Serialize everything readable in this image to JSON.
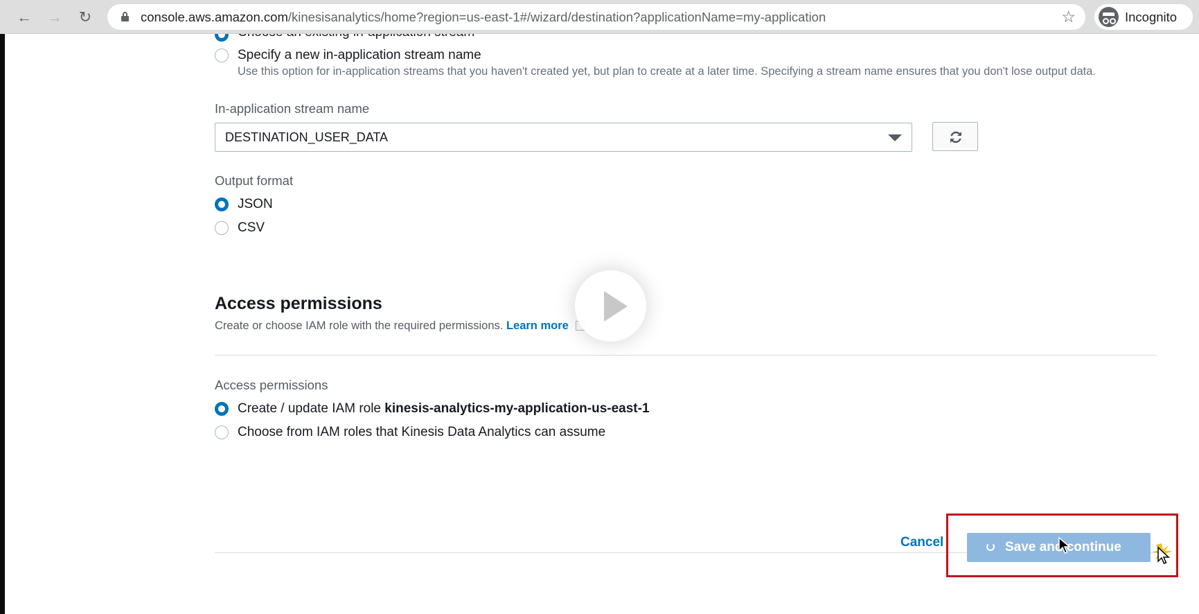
{
  "browser": {
    "url_host": "console.aws.amazon.com",
    "url_path": "/kinesisanalytics/home?region=us-east-1#/wizard/destination?applicationName=my-application",
    "profile_label": "Incognito"
  },
  "stream_options": {
    "existing_label": "Choose an existing in-application stream",
    "new_label": "Specify a new in-application stream name",
    "new_help": "Use this option for in-application streams that you haven't created yet, but plan to create at a later time. Specifying a stream name ensures that you don't lose output data."
  },
  "stream_name": {
    "label": "In-application stream name",
    "value": "DESTINATION_USER_DATA"
  },
  "output_format": {
    "label": "Output format",
    "options": [
      "JSON",
      "CSV"
    ],
    "selected": "JSON"
  },
  "access": {
    "title": "Access permissions",
    "description": "Create or choose IAM role with the required permissions.",
    "learn_more": "Learn more",
    "field_label": "Access permissions",
    "option1_prefix": "Create / update IAM role",
    "option1_role": "kinesis-analytics-my-application-us-east-1",
    "option2": "Choose from IAM roles that Kinesis Data Analytics can assume"
  },
  "footer": {
    "cancel_label": "Cancel",
    "save_label": "Save and continue"
  },
  "colors": {
    "accent": "#0073bb",
    "highlight": "#c0121c",
    "save_disabled": "#8fb8e0"
  }
}
